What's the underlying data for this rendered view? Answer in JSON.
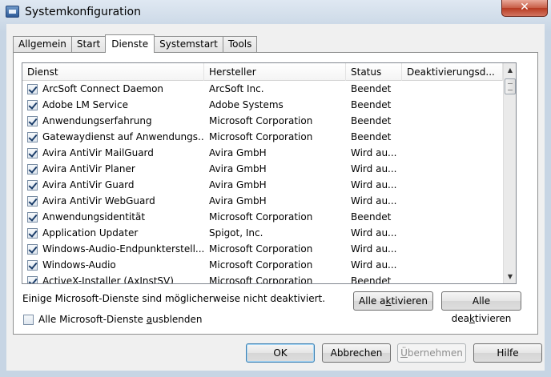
{
  "window": {
    "title": "Systemkonfiguration",
    "close_glyph": "✕"
  },
  "tabs": [
    {
      "label": "Allgemein"
    },
    {
      "label": "Start"
    },
    {
      "label": "Dienste"
    },
    {
      "label": "Systemstart"
    },
    {
      "label": "Tools"
    }
  ],
  "active_tab": "Dienste",
  "columns": [
    "Dienst",
    "Hersteller",
    "Status",
    "Deaktivierungsd..."
  ],
  "services": [
    {
      "checked": true,
      "name": "ArcSoft Connect Daemon",
      "vendor": "ArcSoft Inc.",
      "status": "Beendet",
      "disabled_date": ""
    },
    {
      "checked": true,
      "name": "Adobe LM Service",
      "vendor": "Adobe Systems",
      "status": "Beendet",
      "disabled_date": ""
    },
    {
      "checked": true,
      "name": "Anwendungserfahrung",
      "vendor": "Microsoft Corporation",
      "status": "Beendet",
      "disabled_date": ""
    },
    {
      "checked": true,
      "name": "Gatewaydienst auf Anwendungs...",
      "vendor": "Microsoft Corporation",
      "status": "Beendet",
      "disabled_date": ""
    },
    {
      "checked": true,
      "name": "Avira AntiVir MailGuard",
      "vendor": "Avira GmbH",
      "status": "Wird au...",
      "disabled_date": ""
    },
    {
      "checked": true,
      "name": "Avira AntiVir Planer",
      "vendor": "Avira GmbH",
      "status": "Wird au...",
      "disabled_date": ""
    },
    {
      "checked": true,
      "name": "Avira AntiVir Guard",
      "vendor": "Avira GmbH",
      "status": "Wird au...",
      "disabled_date": ""
    },
    {
      "checked": true,
      "name": "Avira AntiVir WebGuard",
      "vendor": "Avira GmbH",
      "status": "Wird au...",
      "disabled_date": ""
    },
    {
      "checked": true,
      "name": "Anwendungsidentität",
      "vendor": "Microsoft Corporation",
      "status": "Beendet",
      "disabled_date": ""
    },
    {
      "checked": true,
      "name": "Application Updater",
      "vendor": "Spigot, Inc.",
      "status": "Wird au...",
      "disabled_date": ""
    },
    {
      "checked": true,
      "name": "Windows-Audio-Endpunkterstell...",
      "vendor": "Microsoft Corporation",
      "status": "Wird au...",
      "disabled_date": ""
    },
    {
      "checked": true,
      "name": "Windows-Audio",
      "vendor": "Microsoft Corporation",
      "status": "Wird au...",
      "disabled_date": ""
    },
    {
      "checked": true,
      "name": "ActiveX-Installer (AxInstSV)",
      "vendor": "Microsoft Corporation",
      "status": "Beendet",
      "disabled_date": ""
    }
  ],
  "note": "Einige Microsoft-Dienste sind möglicherweise nicht deaktiviert.",
  "enable_all": {
    "pre": "Alle a",
    "key": "k",
    "post": "tivieren"
  },
  "disable_all": {
    "pre": "Alle dea",
    "key": "k",
    "post": "tivieren"
  },
  "hide_ms": {
    "checked": false,
    "pre": "Alle Microsoft-Dienste ",
    "key": "a",
    "post": "usblenden"
  },
  "buttons": {
    "ok": "OK",
    "cancel": "Abbrechen",
    "apply": {
      "pre": "",
      "key": "Ü",
      "post": "bernehmen"
    },
    "help": "Hilfe"
  },
  "icons": {
    "scroll_up": "▲",
    "scroll_down": "▼"
  }
}
